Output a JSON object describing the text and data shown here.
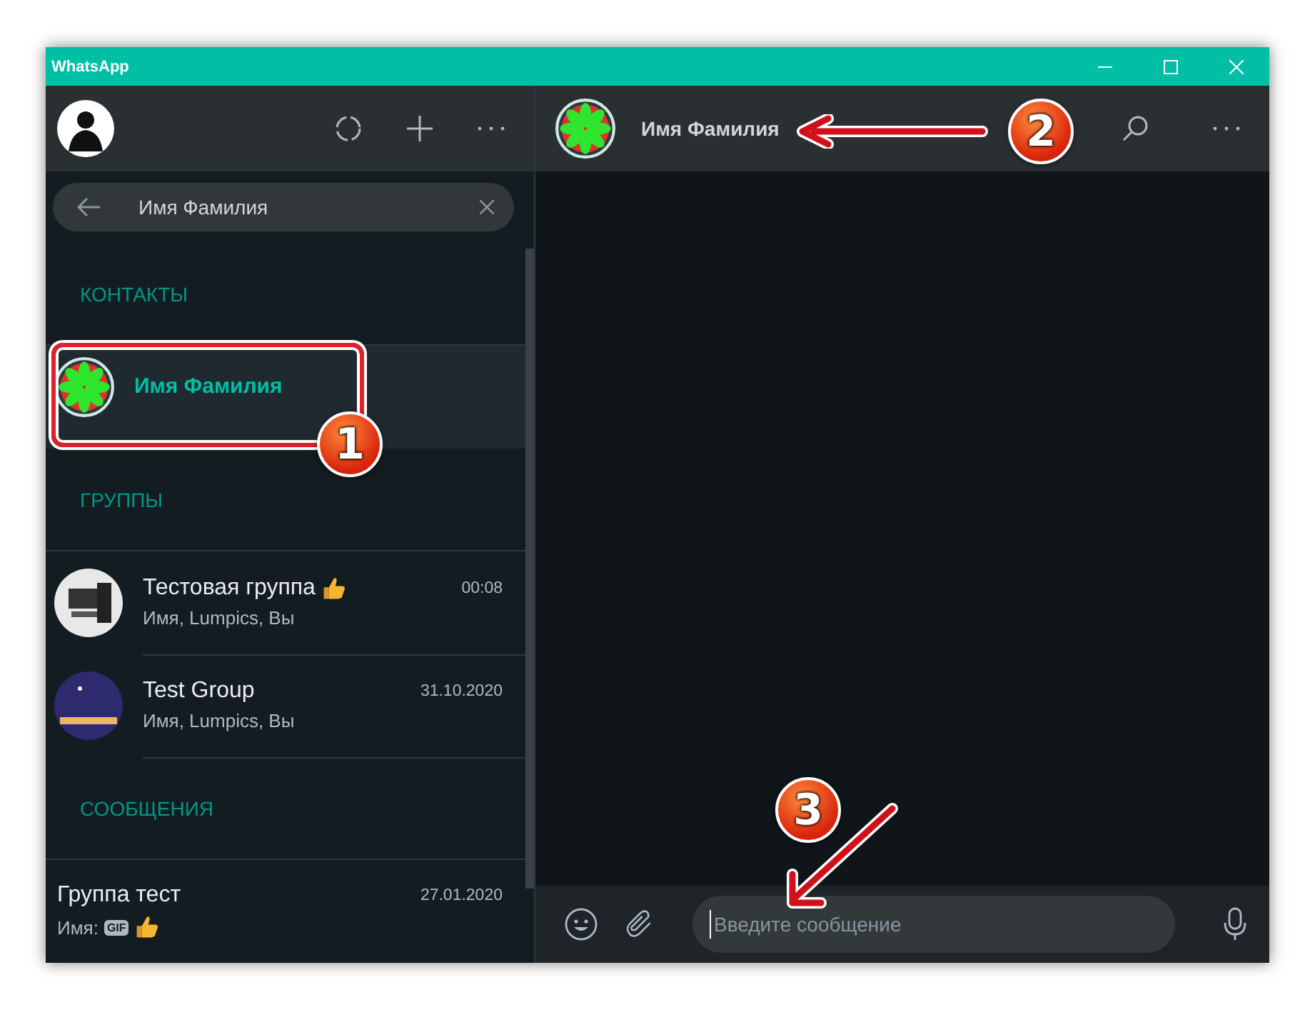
{
  "window": {
    "title": "WhatsApp"
  },
  "sidebar": {
    "search": {
      "value": "Имя Фамилия"
    },
    "sections": [
      {
        "heading": "КОНТАКТЫ",
        "items": [
          {
            "kind": "contact",
            "avatar": {
              "kind": "flower"
            },
            "name": "Имя Фамилия",
            "selected": true
          }
        ]
      },
      {
        "heading": "ГРУППЫ",
        "items": [
          {
            "kind": "chat",
            "avatar": {
              "kind": "photo"
            },
            "name": "Тестовая группа",
            "name_emoji": {
              "kind": "thumbs-up"
            },
            "time": "00:08",
            "preview": [
              {
                "kind": "text",
                "text": "Имя, Lumpics, Вы"
              }
            ],
            "selected": false
          },
          {
            "kind": "chat",
            "avatar": {
              "kind": "night"
            },
            "name": "Test Group",
            "time": "31.10.2020",
            "preview": [
              {
                "kind": "text",
                "text": "Имя, Lumpics, Вы"
              }
            ],
            "selected": false
          }
        ]
      },
      {
        "heading": "СООБЩЕНИЯ",
        "items": [
          {
            "kind": "message",
            "name": "Группа тест",
            "time": "27.01.2020",
            "preview": [
              {
                "kind": "text",
                "text": "Имя:"
              },
              {
                "kind": "badge",
                "text": "GIF"
              },
              {
                "kind": "thumbs-up"
              }
            ],
            "selected": false
          }
        ]
      }
    ]
  },
  "chat": {
    "contact_name": "Имя Фамилия",
    "composer": {
      "placeholder": "Введите сообщение"
    }
  },
  "annotations": [
    {
      "number": "1"
    },
    {
      "number": "2"
    },
    {
      "number": "3"
    }
  ]
}
